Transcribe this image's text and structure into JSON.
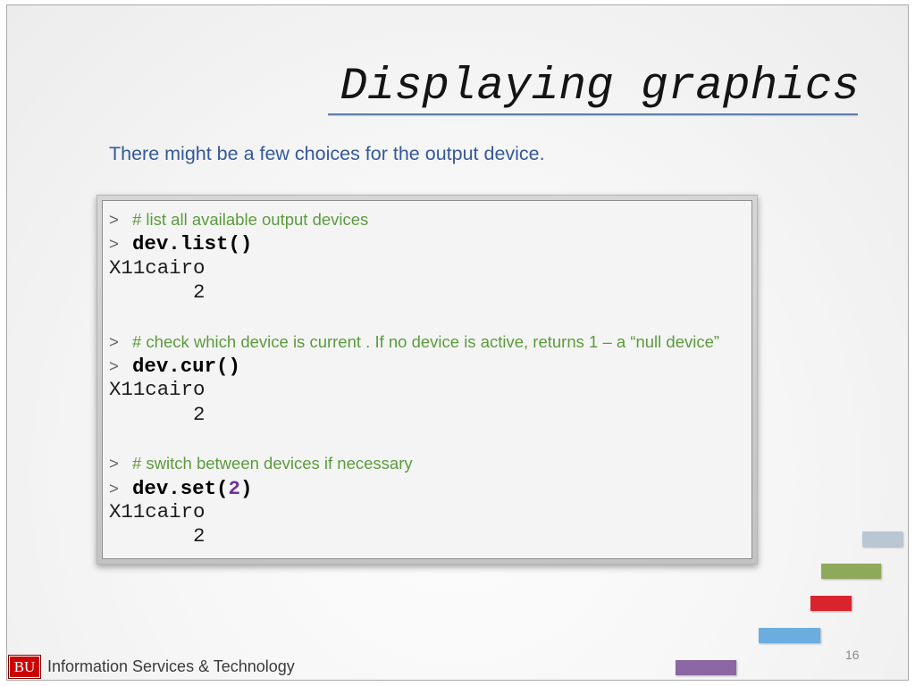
{
  "slide": {
    "title": "Displaying graphics",
    "subtitle": "There might be a few choices for the output device.",
    "page_number": "16"
  },
  "console": {
    "prompt": ">",
    "blocks": [
      {
        "comment": "# list all available output devices",
        "command": "dev.list()",
        "output_name": "X11cairo",
        "output_value": "2"
      },
      {
        "comment": "# check which device is current . If no device is active, returns 1 – a “null device”",
        "command": "dev.cur()",
        "output_name": "X11cairo",
        "output_value": "2"
      },
      {
        "comment": "# switch between devices if necessary",
        "command": "dev.set(",
        "command_arg": "2",
        "command_end": ")",
        "output_name": "X11cairo",
        "output_value": "2"
      }
    ]
  },
  "footer": {
    "logo_text": "BU",
    "organization": "Information Services & Technology"
  },
  "colors": {
    "title_rule": "#5b7fa6",
    "subtitle": "#34599b",
    "comment": "#5b9b3d",
    "argument": "#7030a0",
    "logo": "#cc0000"
  },
  "decor": {
    "bar_colors": [
      "#b9c7d4",
      "#8fa95b",
      "#d9242e",
      "#6badde",
      "#8b68a4"
    ]
  }
}
